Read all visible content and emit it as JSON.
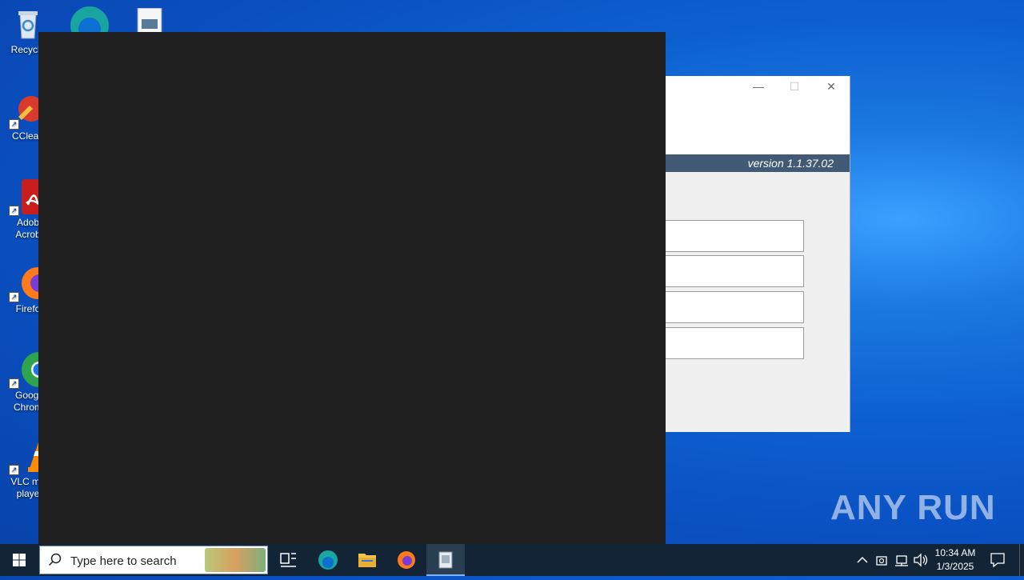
{
  "desktop": {
    "icons": [
      {
        "label": "Recycle",
        "icon": "recycle-bin-icon"
      },
      {
        "label": "CClean",
        "icon": "ccleaner-icon"
      },
      {
        "label": "Adob Acrob",
        "icon": "adobe-acrobat-icon"
      },
      {
        "label": "Firefo",
        "icon": "firefox-icon"
      },
      {
        "label": "Googl Chrom",
        "icon": "chrome-icon"
      },
      {
        "label": "VLC me playe",
        "icon": "vlc-icon"
      }
    ]
  },
  "app_window": {
    "version_label": "version 1.1.37.02",
    "controls": {
      "minimize": "—",
      "maximize": "☐",
      "close": "✕"
    },
    "fields": [
      "",
      "",
      "",
      ""
    ]
  },
  "taskbar": {
    "search_placeholder": "Type here to search",
    "pinned": [
      "task-view-icon",
      "edge-icon",
      "file-explorer-icon",
      "firefox-icon",
      "app-icon"
    ],
    "clock_time": "10:34 AM",
    "clock_date": "1/3/2025"
  },
  "watermark": "ANY RUN",
  "colors": {
    "desktop_accent": "#0d5fd0",
    "taskbar_bg": "#122436",
    "version_bar": "#425a76",
    "black_window": "#1f1f1f"
  }
}
